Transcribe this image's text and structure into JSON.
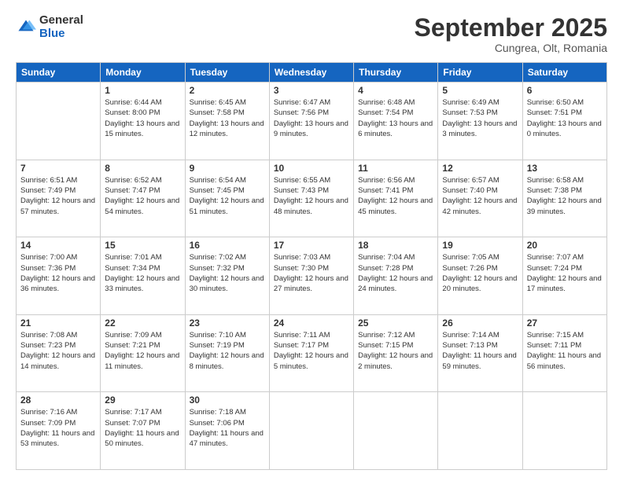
{
  "logo": {
    "general": "General",
    "blue": "Blue"
  },
  "header": {
    "month": "September 2025",
    "location": "Cungrea, Olt, Romania"
  },
  "weekdays": [
    "Sunday",
    "Monday",
    "Tuesday",
    "Wednesday",
    "Thursday",
    "Friday",
    "Saturday"
  ],
  "weeks": [
    [
      {
        "day": "",
        "info": ""
      },
      {
        "day": "1",
        "info": "Sunrise: 6:44 AM\nSunset: 8:00 PM\nDaylight: 13 hours\nand 15 minutes."
      },
      {
        "day": "2",
        "info": "Sunrise: 6:45 AM\nSunset: 7:58 PM\nDaylight: 13 hours\nand 12 minutes."
      },
      {
        "day": "3",
        "info": "Sunrise: 6:47 AM\nSunset: 7:56 PM\nDaylight: 13 hours\nand 9 minutes."
      },
      {
        "day": "4",
        "info": "Sunrise: 6:48 AM\nSunset: 7:54 PM\nDaylight: 13 hours\nand 6 minutes."
      },
      {
        "day": "5",
        "info": "Sunrise: 6:49 AM\nSunset: 7:53 PM\nDaylight: 13 hours\nand 3 minutes."
      },
      {
        "day": "6",
        "info": "Sunrise: 6:50 AM\nSunset: 7:51 PM\nDaylight: 13 hours\nand 0 minutes."
      }
    ],
    [
      {
        "day": "7",
        "info": "Sunrise: 6:51 AM\nSunset: 7:49 PM\nDaylight: 12 hours\nand 57 minutes."
      },
      {
        "day": "8",
        "info": "Sunrise: 6:52 AM\nSunset: 7:47 PM\nDaylight: 12 hours\nand 54 minutes."
      },
      {
        "day": "9",
        "info": "Sunrise: 6:54 AM\nSunset: 7:45 PM\nDaylight: 12 hours\nand 51 minutes."
      },
      {
        "day": "10",
        "info": "Sunrise: 6:55 AM\nSunset: 7:43 PM\nDaylight: 12 hours\nand 48 minutes."
      },
      {
        "day": "11",
        "info": "Sunrise: 6:56 AM\nSunset: 7:41 PM\nDaylight: 12 hours\nand 45 minutes."
      },
      {
        "day": "12",
        "info": "Sunrise: 6:57 AM\nSunset: 7:40 PM\nDaylight: 12 hours\nand 42 minutes."
      },
      {
        "day": "13",
        "info": "Sunrise: 6:58 AM\nSunset: 7:38 PM\nDaylight: 12 hours\nand 39 minutes."
      }
    ],
    [
      {
        "day": "14",
        "info": "Sunrise: 7:00 AM\nSunset: 7:36 PM\nDaylight: 12 hours\nand 36 minutes."
      },
      {
        "day": "15",
        "info": "Sunrise: 7:01 AM\nSunset: 7:34 PM\nDaylight: 12 hours\nand 33 minutes."
      },
      {
        "day": "16",
        "info": "Sunrise: 7:02 AM\nSunset: 7:32 PM\nDaylight: 12 hours\nand 30 minutes."
      },
      {
        "day": "17",
        "info": "Sunrise: 7:03 AM\nSunset: 7:30 PM\nDaylight: 12 hours\nand 27 minutes."
      },
      {
        "day": "18",
        "info": "Sunrise: 7:04 AM\nSunset: 7:28 PM\nDaylight: 12 hours\nand 24 minutes."
      },
      {
        "day": "19",
        "info": "Sunrise: 7:05 AM\nSunset: 7:26 PM\nDaylight: 12 hours\nand 20 minutes."
      },
      {
        "day": "20",
        "info": "Sunrise: 7:07 AM\nSunset: 7:24 PM\nDaylight: 12 hours\nand 17 minutes."
      }
    ],
    [
      {
        "day": "21",
        "info": "Sunrise: 7:08 AM\nSunset: 7:23 PM\nDaylight: 12 hours\nand 14 minutes."
      },
      {
        "day": "22",
        "info": "Sunrise: 7:09 AM\nSunset: 7:21 PM\nDaylight: 12 hours\nand 11 minutes."
      },
      {
        "day": "23",
        "info": "Sunrise: 7:10 AM\nSunset: 7:19 PM\nDaylight: 12 hours\nand 8 minutes."
      },
      {
        "day": "24",
        "info": "Sunrise: 7:11 AM\nSunset: 7:17 PM\nDaylight: 12 hours\nand 5 minutes."
      },
      {
        "day": "25",
        "info": "Sunrise: 7:12 AM\nSunset: 7:15 PM\nDaylight: 12 hours\nand 2 minutes."
      },
      {
        "day": "26",
        "info": "Sunrise: 7:14 AM\nSunset: 7:13 PM\nDaylight: 11 hours\nand 59 minutes."
      },
      {
        "day": "27",
        "info": "Sunrise: 7:15 AM\nSunset: 7:11 PM\nDaylight: 11 hours\nand 56 minutes."
      }
    ],
    [
      {
        "day": "28",
        "info": "Sunrise: 7:16 AM\nSunset: 7:09 PM\nDaylight: 11 hours\nand 53 minutes."
      },
      {
        "day": "29",
        "info": "Sunrise: 7:17 AM\nSunset: 7:07 PM\nDaylight: 11 hours\nand 50 minutes."
      },
      {
        "day": "30",
        "info": "Sunrise: 7:18 AM\nSunset: 7:06 PM\nDaylight: 11 hours\nand 47 minutes."
      },
      {
        "day": "",
        "info": ""
      },
      {
        "day": "",
        "info": ""
      },
      {
        "day": "",
        "info": ""
      },
      {
        "day": "",
        "info": ""
      }
    ]
  ]
}
